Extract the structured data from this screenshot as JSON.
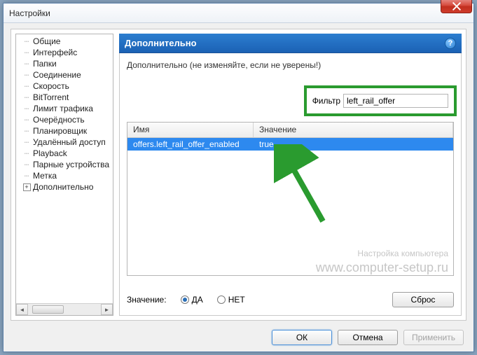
{
  "window": {
    "title": "Настройки"
  },
  "tree": {
    "items": [
      "Общие",
      "Интерфейс",
      "Папки",
      "Соединение",
      "Скорость",
      "BitTorrent",
      "Лимит трафика",
      "Очерёдность",
      "Планировщик",
      "Удалённый доступ",
      "Playback",
      "Парные устройства",
      "Метка",
      "Дополнительно"
    ]
  },
  "panel": {
    "title": "Дополнительно",
    "warning": "Дополнительно (не изменяйте, если не уверены!)",
    "filter_label": "Фильтр",
    "filter_value": "left_rail_offer",
    "columns": {
      "name": "Имя",
      "value": "Значение"
    },
    "rows": [
      {
        "name": "offers.left_rail_offer_enabled",
        "value": "true"
      }
    ],
    "value_label": "Значение:",
    "opt_yes": "ДА",
    "opt_no": "НЕТ",
    "reset_btn": "Сброс"
  },
  "footer": {
    "ok": "ОК",
    "cancel": "Отмена",
    "apply": "Применить"
  },
  "watermark": {
    "line1": "Настройка компьютера",
    "line2": "www.computer-setup.ru"
  }
}
